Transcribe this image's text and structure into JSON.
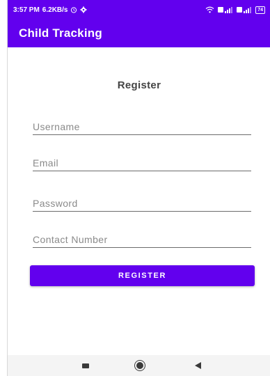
{
  "status_bar": {
    "time": "3:57 PM",
    "speed": "6.2KB/s",
    "icons_left": [
      "alarm-icon",
      "settings-icon"
    ],
    "icons_right": [
      "wifi-icon",
      "signal-icon",
      "signal-icon-2",
      "battery-icon"
    ],
    "battery_level": "74"
  },
  "app_bar": {
    "title": "Child Tracking"
  },
  "form": {
    "heading": "Register",
    "username_placeholder": "Username",
    "email_placeholder": "Email",
    "password_placeholder": "Password",
    "contact_placeholder": "Contact Number",
    "register_label": "REGISTER"
  },
  "nav": {
    "icons": [
      "recent-apps-icon",
      "home-icon",
      "back-icon"
    ]
  },
  "colors": {
    "primary": "#6200ee",
    "text": "#444444",
    "hint": "#8a8a8a",
    "nav_bg": "#f4f4f4"
  }
}
